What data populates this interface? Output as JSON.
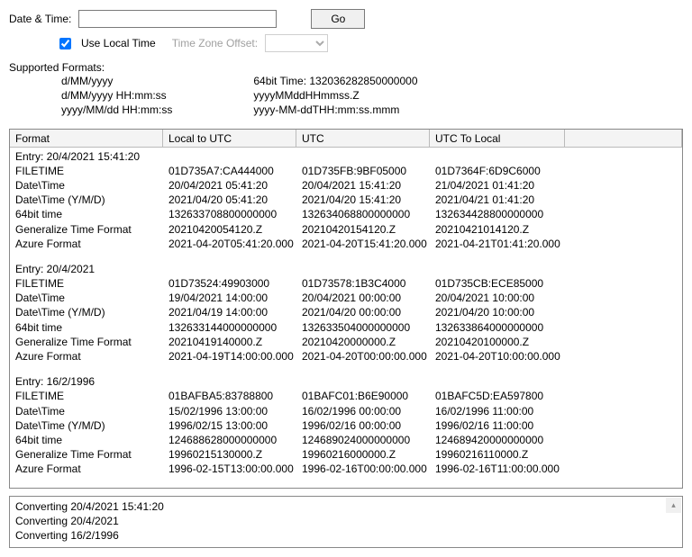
{
  "datetime_label": "Date & Time:",
  "datetime_value": "",
  "go_label": "Go",
  "use_local_time": {
    "label": "Use Local Time",
    "checked": true
  },
  "timezone_offset_label": "Time Zone Offset:",
  "timezone_offset_value": "",
  "supported_formats_heading": "Supported Formats:",
  "formats_left": [
    "d/MM/yyyy",
    "d/MM/yyyy HH:mm:ss",
    "yyyy/MM/dd HH:mm:ss"
  ],
  "formats_right": [
    "64bit Time: 132036282850000000",
    "yyyyMMddHHmmss.Z",
    "yyyy-MM-ddTHH:mm:ss.mmm"
  ],
  "columns": [
    "Format",
    "Local to UTC",
    "UTC",
    "UTC To Local",
    ""
  ],
  "entries": [
    {
      "title": "Entry: 20/4/2021 15:41:20",
      "rows": [
        {
          "label": "FILETIME",
          "local": "01D735A7:CA444000",
          "utc": "01D735FB:9BF05000",
          "utcl": "01D7364F:6D9C6000"
        },
        {
          "label": "Date\\Time",
          "local": "20/04/2021 05:41:20",
          "utc": "20/04/2021 15:41:20",
          "utcl": "21/04/2021 01:41:20"
        },
        {
          "label": "Date\\Time (Y/M/D)",
          "local": "2021/04/20 05:41:20",
          "utc": "2021/04/20 15:41:20",
          "utcl": "2021/04/21 01:41:20"
        },
        {
          "label": "64bit time",
          "local": "132633708800000000",
          "utc": "132634068800000000",
          "utcl": "132634428800000000"
        },
        {
          "label": "Generalize Time Format",
          "local": "20210420054120.Z",
          "utc": "20210420154120.Z",
          "utcl": "20210421014120.Z"
        },
        {
          "label": "Azure Format",
          "local": "2021-04-20T05:41:20.000",
          "utc": "2021-04-20T15:41:20.000",
          "utcl": "2021-04-21T01:41:20.000"
        }
      ]
    },
    {
      "title": "Entry: 20/4/2021",
      "rows": [
        {
          "label": "FILETIME",
          "local": "01D73524:49903000",
          "utc": "01D73578:1B3C4000",
          "utcl": "01D735CB:ECE85000"
        },
        {
          "label": "Date\\Time",
          "local": "19/04/2021 14:00:00",
          "utc": "20/04/2021 00:00:00",
          "utcl": "20/04/2021 10:00:00"
        },
        {
          "label": "Date\\Time (Y/M/D)",
          "local": "2021/04/19 14:00:00",
          "utc": "2021/04/20 00:00:00",
          "utcl": "2021/04/20 10:00:00"
        },
        {
          "label": "64bit time",
          "local": "132633144000000000",
          "utc": "132633504000000000",
          "utcl": "132633864000000000"
        },
        {
          "label": "Generalize Time Format",
          "local": "20210419140000.Z",
          "utc": "20210420000000.Z",
          "utcl": "20210420100000.Z"
        },
        {
          "label": "Azure Format",
          "local": "2021-04-19T14:00:00.000",
          "utc": "2021-04-20T00:00:00.000",
          "utcl": "2021-04-20T10:00:00.000"
        }
      ]
    },
    {
      "title": "Entry: 16/2/1996",
      "rows": [
        {
          "label": "FILETIME",
          "local": "01BAFBA5:83788800",
          "utc": "01BAFC01:B6E90000",
          "utcl": "01BAFC5D:EA597800"
        },
        {
          "label": "Date\\Time",
          "local": "15/02/1996 13:00:00",
          "utc": "16/02/1996 00:00:00",
          "utcl": "16/02/1996 11:00:00"
        },
        {
          "label": "Date\\Time (Y/M/D)",
          "local": "1996/02/15 13:00:00",
          "utc": "1996/02/16 00:00:00",
          "utcl": "1996/02/16 11:00:00"
        },
        {
          "label": "64bit time",
          "local": "124688628000000000",
          "utc": "124689024000000000",
          "utcl": "124689420000000000"
        },
        {
          "label": "Generalize Time Format",
          "local": "19960215130000.Z",
          "utc": "19960216000000.Z",
          "utcl": "19960216110000.Z"
        },
        {
          "label": "Azure Format",
          "local": "1996-02-15T13:00:00.000",
          "utc": "1996-02-16T00:00:00.000",
          "utcl": "1996-02-16T11:00:00.000"
        }
      ]
    }
  ],
  "log": [
    "Converting 20/4/2021 15:41:20",
    "Converting 20/4/2021",
    "Converting 16/2/1996"
  ]
}
